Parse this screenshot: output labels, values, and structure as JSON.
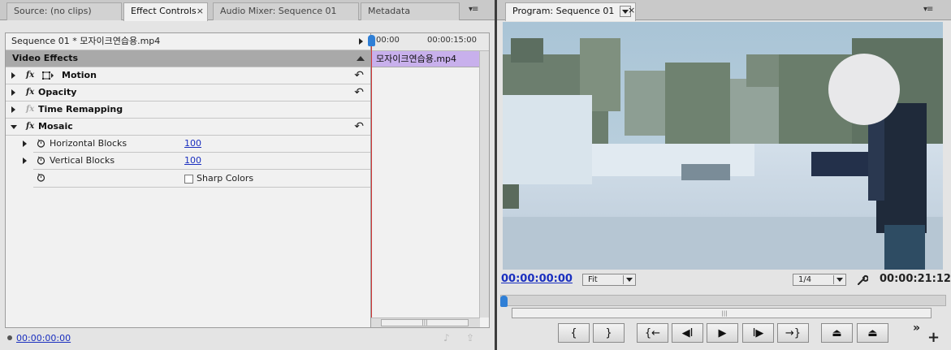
{
  "left_panel": {
    "tabs": [
      {
        "label": "Source: (no clips)"
      },
      {
        "label": "Effect Controls"
      },
      {
        "label": "Audio Mixer: Sequence 01"
      },
      {
        "label": "Metadata"
      }
    ],
    "close_glyph": "×",
    "menu_glyph": "▾≡",
    "breadcrumb": "Sequence 01 * 모자이크연습용.mp4",
    "section_header": "Video Effects",
    "effects": [
      {
        "fx": "fx",
        "label": "Motion",
        "expanded": false
      },
      {
        "fx": "fx",
        "label": "Opacity",
        "expanded": false
      },
      {
        "fx": "fx",
        "label": "Time Remapping",
        "expanded": false
      },
      {
        "fx": "fx",
        "label": "Mosaic",
        "expanded": true
      }
    ],
    "properties": [
      {
        "label": "Horizontal Blocks",
        "value": "100"
      },
      {
        "label": "Vertical Blocks",
        "value": "100"
      },
      {
        "label": "Sharp Colors",
        "checked": false
      }
    ],
    "reset_glyph": "↶",
    "timeline": {
      "start": "00:00",
      "end": "00:00:15:00",
      "clip_name": "모자이크연습용.mp4"
    },
    "footer_timecode": "00:00:00:00"
  },
  "right_panel": {
    "tab_label": "Program: Sequence 01",
    "close_glyph": "×",
    "menu_glyph": "▾≡",
    "current_timecode": "00:00:00:00",
    "zoom_select": "Fit",
    "resolution_select": "1/4",
    "duration_timecode": "00:00:21:12",
    "controls": [
      {
        "name": "mark-in",
        "glyph": "{"
      },
      {
        "name": "mark-out",
        "glyph": "}"
      },
      {
        "name": "go-to-in",
        "glyph": "{←"
      },
      {
        "name": "step-back",
        "glyph": "◀I"
      },
      {
        "name": "play",
        "glyph": "▶"
      },
      {
        "name": "step-forward",
        "glyph": "I▶"
      },
      {
        "name": "go-to-out",
        "glyph": "→}"
      },
      {
        "name": "lift",
        "glyph": "⏏"
      },
      {
        "name": "extract",
        "glyph": "⏏"
      }
    ],
    "more_glyph": "»",
    "add_glyph": "+"
  }
}
